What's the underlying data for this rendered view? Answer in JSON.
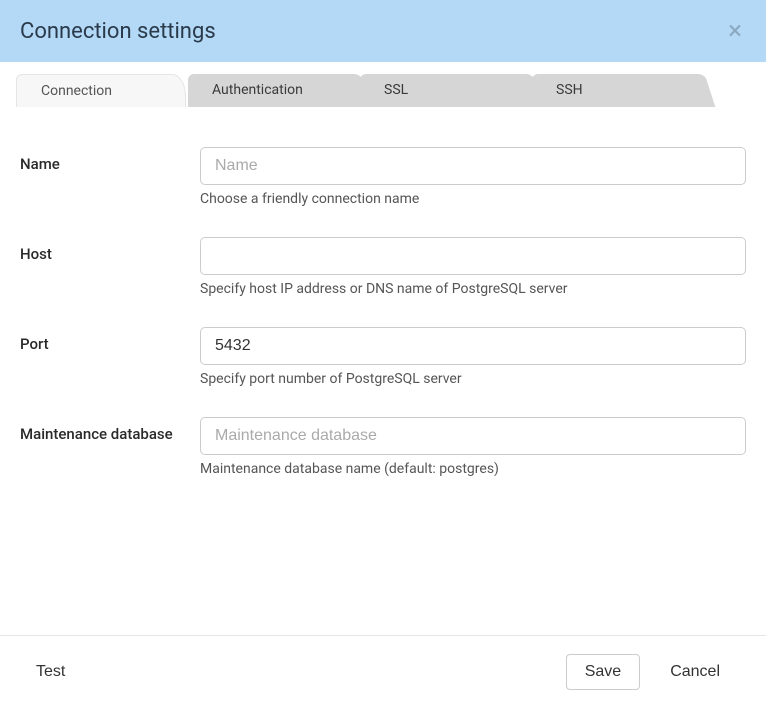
{
  "header": {
    "title": "Connection settings"
  },
  "tabs": [
    {
      "label": "Connection",
      "active": true
    },
    {
      "label": "Authentication",
      "active": false
    },
    {
      "label": "SSL",
      "active": false
    },
    {
      "label": "SSH",
      "active": false
    }
  ],
  "fields": {
    "name": {
      "label": "Name",
      "placeholder": "Name",
      "value": "",
      "hint": "Choose a friendly connection name"
    },
    "host": {
      "label": "Host",
      "placeholder": "",
      "value": "",
      "hint": "Specify host IP address or DNS name of PostgreSQL server"
    },
    "port": {
      "label": "Port",
      "placeholder": "",
      "value": "5432",
      "hint": "Specify port number of PostgreSQL server"
    },
    "maintdb": {
      "label": "Maintenance database",
      "placeholder": "Maintenance database",
      "value": "",
      "hint": "Maintenance database name (default: postgres)"
    }
  },
  "footer": {
    "test_label": "Test",
    "save_label": "Save",
    "cancel_label": "Cancel"
  }
}
